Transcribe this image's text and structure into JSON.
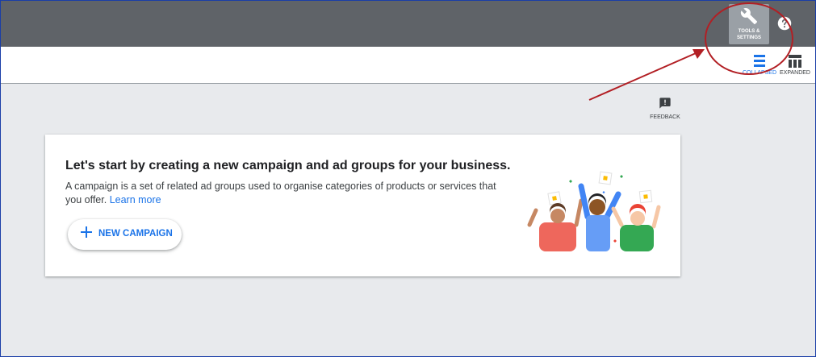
{
  "topbar": {
    "tools_label": "TOOLS &\nSETTINGS",
    "tools_icon": "wrench-icon",
    "help_icon": "help-icon"
  },
  "view_options": {
    "collapsed_label": "COLLAPSED",
    "expanded_label": "EXPANDED",
    "active": "collapsed"
  },
  "feedback": {
    "label": "FEEDBACK",
    "icon": "feedback-icon"
  },
  "card": {
    "title": "Let's start by creating a new campaign and ad groups for your business.",
    "description": "A campaign is a set of related ad groups used to organise categories of products or services that you offer.",
    "learn_more": "Learn more",
    "new_campaign_label": "NEW CAMPAIGN"
  },
  "annotation_color": "#b21f24",
  "colors": {
    "accent": "#1a73e8",
    "topbar": "#5f6368",
    "background": "#e8eaed"
  }
}
